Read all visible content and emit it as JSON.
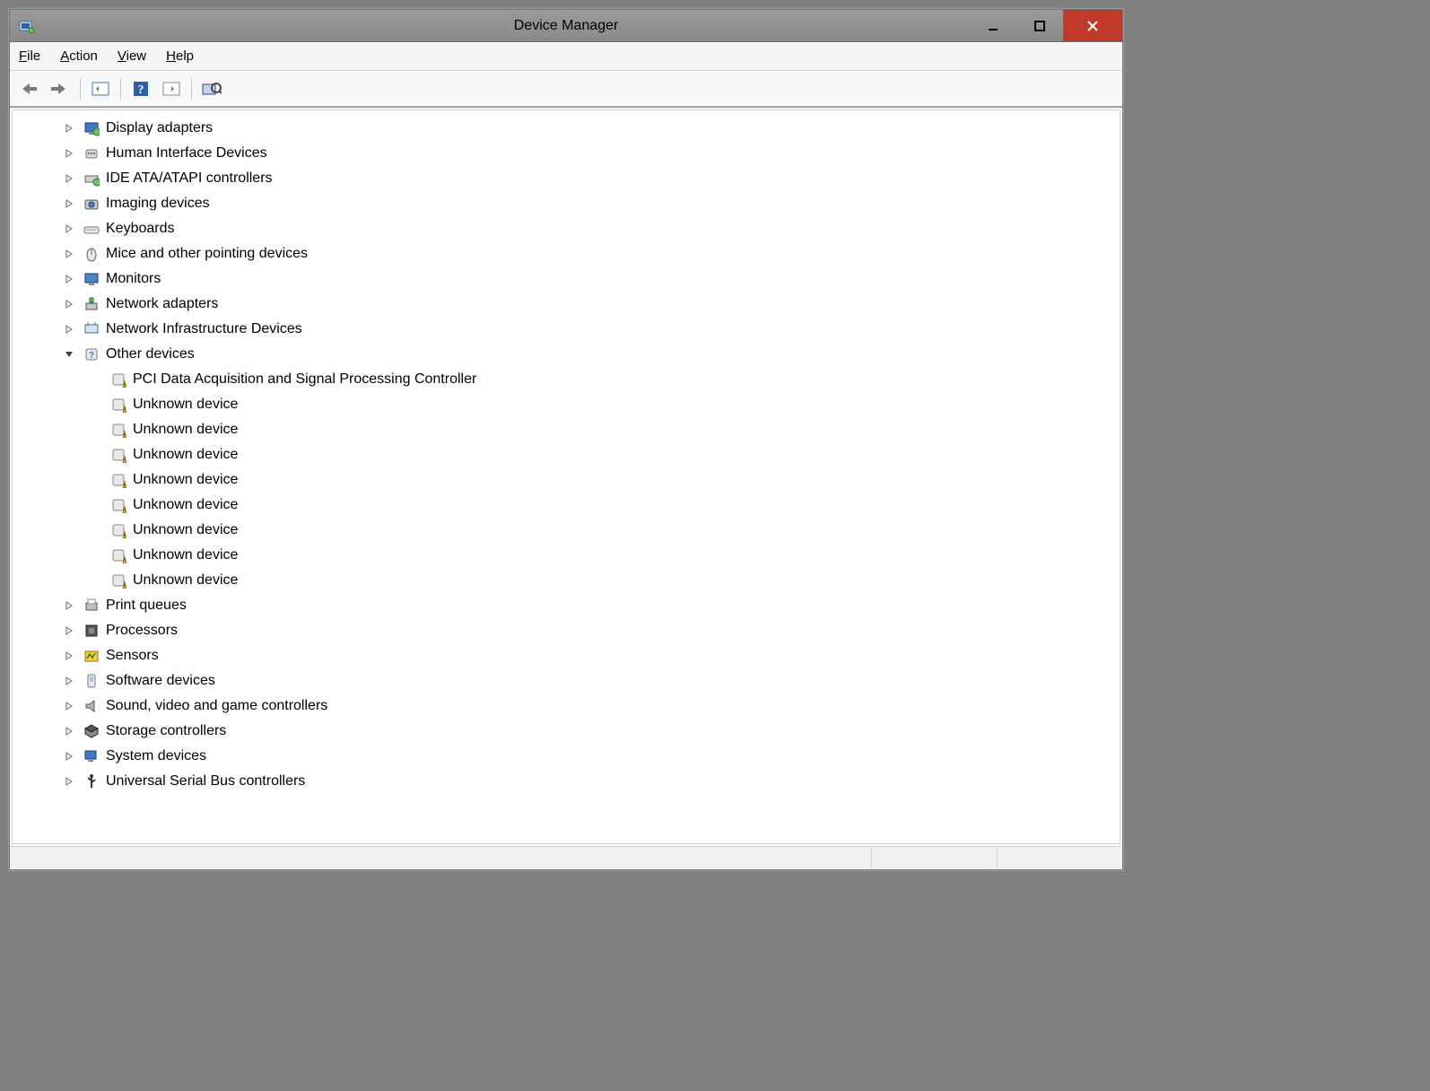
{
  "window": {
    "title": "Device Manager"
  },
  "menu": {
    "file": "File",
    "action": "Action",
    "view": "View",
    "help": "Help"
  },
  "toolbar": {
    "back": "Back",
    "forward": "Forward",
    "show_hidden": "Show hidden devices",
    "help": "Help",
    "properties": "Properties",
    "scan": "Scan for hardware changes"
  },
  "tree": {
    "items": [
      {
        "label": "Display adapters",
        "icon": "display",
        "expanded": false
      },
      {
        "label": "Human Interface Devices",
        "icon": "hid",
        "expanded": false
      },
      {
        "label": "IDE ATA/ATAPI controllers",
        "icon": "ide",
        "expanded": false
      },
      {
        "label": "Imaging devices",
        "icon": "camera",
        "expanded": false
      },
      {
        "label": "Keyboards",
        "icon": "keyboard",
        "expanded": false
      },
      {
        "label": "Mice and other pointing devices",
        "icon": "mouse",
        "expanded": false
      },
      {
        "label": "Monitors",
        "icon": "monitor",
        "expanded": false
      },
      {
        "label": "Network adapters",
        "icon": "network",
        "expanded": false
      },
      {
        "label": "Network Infrastructure Devices",
        "icon": "network-infra",
        "expanded": false
      },
      {
        "label": "Other devices",
        "icon": "other",
        "expanded": true,
        "children": [
          {
            "label": "PCI Data Acquisition and Signal Processing Controller",
            "icon": "warning"
          },
          {
            "label": "Unknown device",
            "icon": "warning"
          },
          {
            "label": "Unknown device",
            "icon": "warning"
          },
          {
            "label": "Unknown device",
            "icon": "warning"
          },
          {
            "label": "Unknown device",
            "icon": "warning"
          },
          {
            "label": "Unknown device",
            "icon": "warning"
          },
          {
            "label": "Unknown device",
            "icon": "warning"
          },
          {
            "label": "Unknown device",
            "icon": "warning"
          },
          {
            "label": "Unknown device",
            "icon": "warning"
          }
        ]
      },
      {
        "label": "Print queues",
        "icon": "printer",
        "expanded": false
      },
      {
        "label": "Processors",
        "icon": "cpu",
        "expanded": false
      },
      {
        "label": "Sensors",
        "icon": "sensor",
        "expanded": false
      },
      {
        "label": "Software devices",
        "icon": "software",
        "expanded": false
      },
      {
        "label": "Sound, video and game controllers",
        "icon": "sound",
        "expanded": false
      },
      {
        "label": "Storage controllers",
        "icon": "storage",
        "expanded": false
      },
      {
        "label": "System devices",
        "icon": "system",
        "expanded": false
      },
      {
        "label": "Universal Serial Bus controllers",
        "icon": "usb",
        "expanded": false
      }
    ]
  }
}
